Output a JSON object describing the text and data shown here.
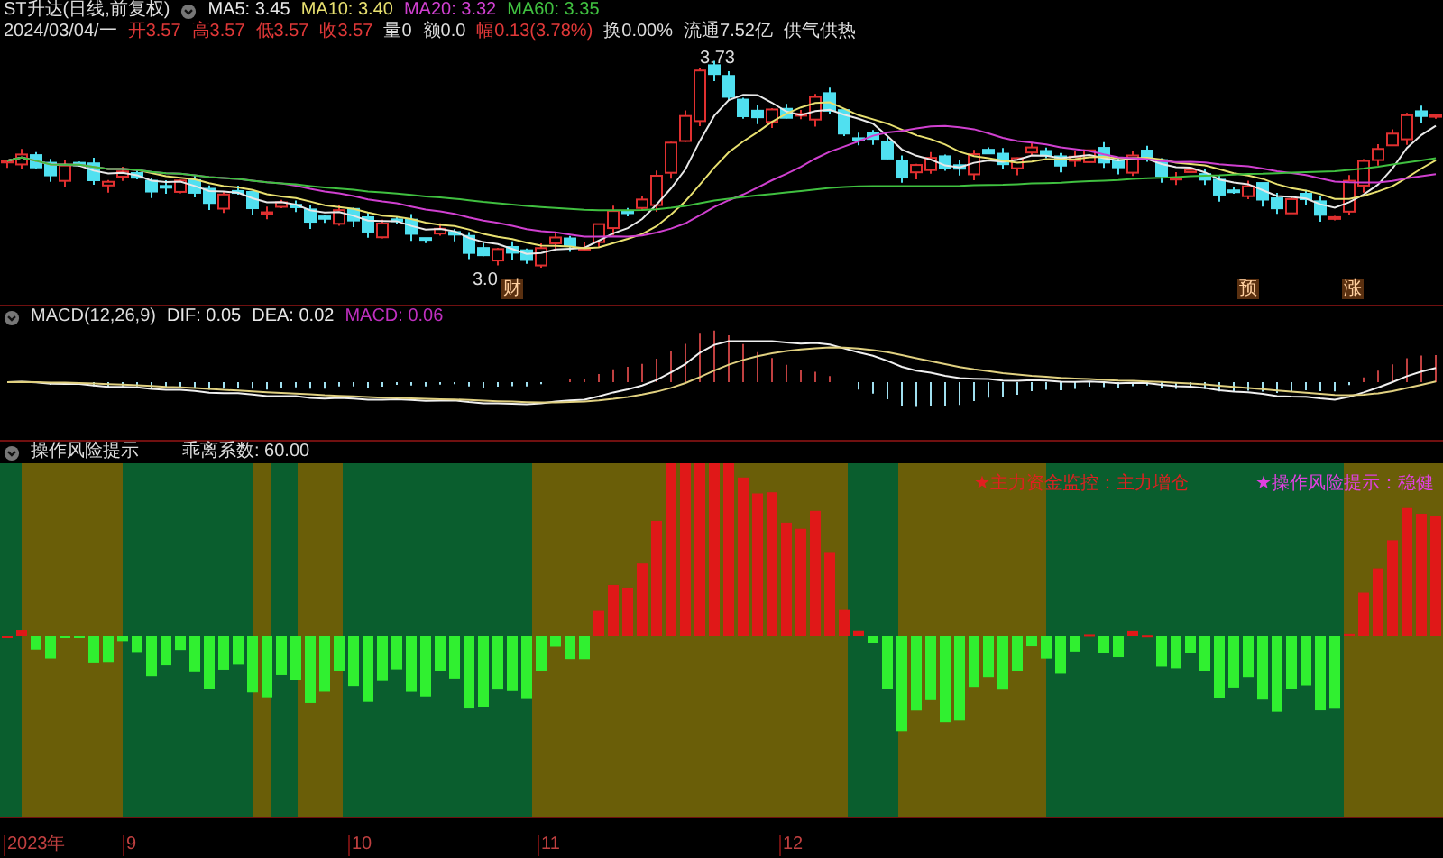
{
  "header": {
    "title": "ST升达(日线,前复权)",
    "moving_averages": [
      {
        "label": "MA5:",
        "value": "3.45",
        "color": "#e8e8e8"
      },
      {
        "label": "MA10:",
        "value": "3.40",
        "color": "#e8e070"
      },
      {
        "label": "MA20:",
        "value": "3.32",
        "color": "#d040d0"
      },
      {
        "label": "MA60:",
        "value": "3.35",
        "color": "#40c040"
      }
    ]
  },
  "quote": {
    "date": "2024/03/04/一",
    "fields": [
      {
        "label": "开",
        "value": "3.57",
        "kind": "up"
      },
      {
        "label": "高",
        "value": "3.57",
        "kind": "up"
      },
      {
        "label": "低",
        "value": "3.57",
        "kind": "up"
      },
      {
        "label": "收",
        "value": "3.57",
        "kind": "up"
      },
      {
        "label": "量",
        "value": "0",
        "kind": "flat"
      },
      {
        "label": "额",
        "value": "0.0",
        "kind": "flat"
      },
      {
        "label": "幅",
        "value": "0.13(3.78%)",
        "kind": "up"
      },
      {
        "label": "换",
        "value": "0.00%",
        "kind": "flat"
      },
      {
        "label": "流通",
        "value": "7.52亿",
        "kind": "flat"
      }
    ],
    "sector": "供气供热"
  },
  "price_chart": {
    "high_label": "3.73",
    "low_label": "3.0",
    "markers": [
      "财",
      "预",
      "涨"
    ]
  },
  "macd": {
    "title": "MACD(12,26,9)",
    "values": [
      {
        "label": "DIF:",
        "value": "0.05",
        "color": "#e8e8e8"
      },
      {
        "label": "DEA:",
        "value": "0.02",
        "color": "#e8e8e8"
      },
      {
        "label": "MACD:",
        "value": "0.06",
        "color": "#c030c0"
      }
    ]
  },
  "risk": {
    "title": "操作风险提示",
    "coefficient": "乖离系数: 60.00",
    "signals": [
      {
        "text": "★主力资金监控：主力增仓",
        "color": "#e02020"
      },
      {
        "text": "★操作风险提示：稳健",
        "color": "#e040e0"
      }
    ]
  },
  "axis": [
    "2023年",
    "9",
    "10",
    "11",
    "12"
  ]
}
